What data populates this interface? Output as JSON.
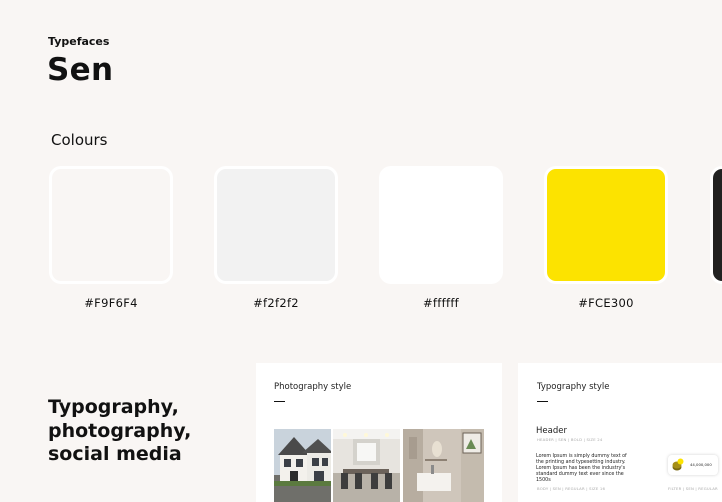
{
  "typography": {
    "label": "Typefaces",
    "font_name": "Sen"
  },
  "colours": {
    "title": "Colours",
    "swatches": [
      {
        "code": "#F9F6F4",
        "hex": "#F9F6F4"
      },
      {
        "code": "#f2f2f2",
        "hex": "#f2f2f2"
      },
      {
        "code": "#ffffff",
        "hex": "#ffffff"
      },
      {
        "code": "#FCE300",
        "hex": "#FCE300"
      },
      {
        "hex": "#222222"
      }
    ]
  },
  "section": {
    "heading_lines": [
      "Typography,",
      "photography,",
      "social media"
    ]
  },
  "photography_card": {
    "title": "Photography style",
    "photos": [
      "house-exterior",
      "dining-interior",
      "bathroom-interior"
    ]
  },
  "typography_card": {
    "title": "Typography style",
    "header_sample": "Header",
    "header_meta": "HEADER | SEN | BOLD | SIZE 24",
    "body_sample": "Lorem Ipsum is simply dummy text of the printing and typesetting industry. Lorem Ipsum has been the industry's standard dummy text ever since the 1500s",
    "body_meta": "BODY | SEN | REGULAR | SIZE 16",
    "filter_meta": "FILTER | SEN | REGULAR",
    "price_value": "44,000,000"
  }
}
